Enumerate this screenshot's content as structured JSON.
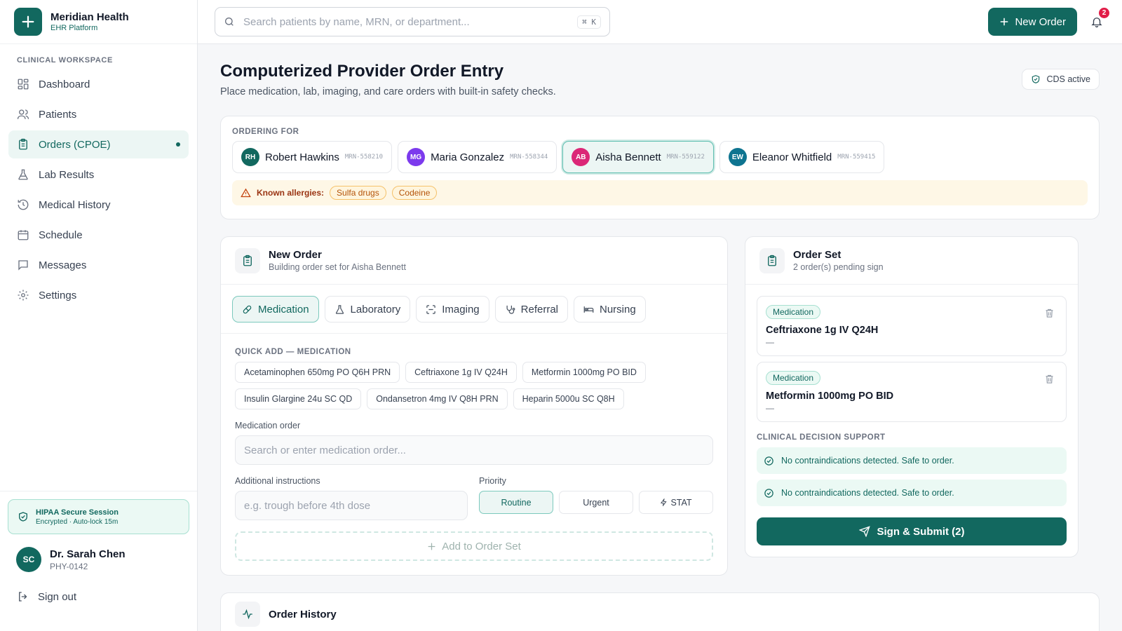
{
  "brand": {
    "name": "Meridian Health",
    "subtitle": "EHR Platform"
  },
  "sidebar": {
    "section_label": "CLINICAL WORKSPACE",
    "items": [
      {
        "label": "Dashboard",
        "icon": "dashboard-icon"
      },
      {
        "label": "Patients",
        "icon": "users-icon"
      },
      {
        "label": "Orders (CPOE)",
        "icon": "clipboard-icon",
        "active": true
      },
      {
        "label": "Lab Results",
        "icon": "flask-icon"
      },
      {
        "label": "Medical History",
        "icon": "history-icon"
      },
      {
        "label": "Schedule",
        "icon": "calendar-icon"
      },
      {
        "label": "Messages",
        "icon": "message-icon"
      },
      {
        "label": "Settings",
        "icon": "gear-icon"
      }
    ],
    "session": {
      "title": "HIPAA Secure Session",
      "subtitle": "Encrypted · Auto-lock 15m"
    },
    "user": {
      "initials": "SC",
      "name": "Dr. Sarah Chen",
      "id": "PHY-0142"
    },
    "signout_label": "Sign out"
  },
  "topbar": {
    "search_placeholder": "Search patients by name, MRN, or department...",
    "shortcut": "⌘ K",
    "new_order_label": "New Order",
    "notification_count": "2"
  },
  "page": {
    "title": "Computerized Provider Order Entry",
    "subtitle": "Place medication, lab, imaging, and care orders with built-in safety checks.",
    "cds_status": "CDS active"
  },
  "ordering": {
    "label": "ORDERING FOR",
    "patients": [
      {
        "initials": "RH",
        "name": "Robert Hawkins",
        "mrn": "MRN-558210",
        "color": "#12685f"
      },
      {
        "initials": "MG",
        "name": "Maria Gonzalez",
        "mrn": "MRN-558344",
        "color": "#7c3aed"
      },
      {
        "initials": "AB",
        "name": "Aisha Bennett",
        "mrn": "MRN-559122",
        "color": "#db2777",
        "active": true
      },
      {
        "initials": "EW",
        "name": "Eleanor Whitfield",
        "mrn": "MRN-559415",
        "color": "#0e7490"
      }
    ],
    "allergy_label": "Known allergies:",
    "allergies": [
      "Sulfa drugs",
      "Codeine"
    ]
  },
  "new_order": {
    "title": "New Order",
    "subtitle": "Building order set for Aisha Bennett",
    "tabs": [
      {
        "label": "Medication",
        "icon": "pill-icon",
        "active": true
      },
      {
        "label": "Laboratory",
        "icon": "flask-icon"
      },
      {
        "label": "Imaging",
        "icon": "scan-icon"
      },
      {
        "label": "Referral",
        "icon": "stethoscope-icon"
      },
      {
        "label": "Nursing",
        "icon": "bed-icon"
      }
    ],
    "quick_label": "QUICK ADD — MEDICATION",
    "quick_items": [
      "Acetaminophen 650mg PO Q6H PRN",
      "Ceftriaxone 1g IV Q24H",
      "Metformin 1000mg PO BID",
      "Insulin Glargine 24u SC QD",
      "Ondansetron 4mg IV Q8H PRN",
      "Heparin 5000u SC Q8H"
    ],
    "med_label": "Medication order",
    "med_placeholder": "Search or enter medication order...",
    "instr_label": "Additional instructions",
    "instr_placeholder": "e.g. trough before 4th dose",
    "priority_label": "Priority",
    "priorities": [
      {
        "label": "Routine",
        "active": true
      },
      {
        "label": "Urgent"
      },
      {
        "label": "STAT"
      }
    ],
    "add_label": "Add to Order Set"
  },
  "order_set": {
    "title": "Order Set",
    "subtitle": "2 order(s) pending sign",
    "items": [
      {
        "type": "Medication",
        "name": "Ceftriaxone 1g IV Q24H",
        "detail": "—"
      },
      {
        "type": "Medication",
        "name": "Metformin 1000mg PO BID",
        "detail": "—"
      }
    ],
    "cds_label": "CLINICAL DECISION SUPPORT",
    "cds_messages": [
      "No contraindications detected. Safe to order.",
      "No contraindications detected. Safe to order."
    ],
    "submit_label": "Sign & Submit (2)"
  },
  "history": {
    "title": "Order History"
  }
}
